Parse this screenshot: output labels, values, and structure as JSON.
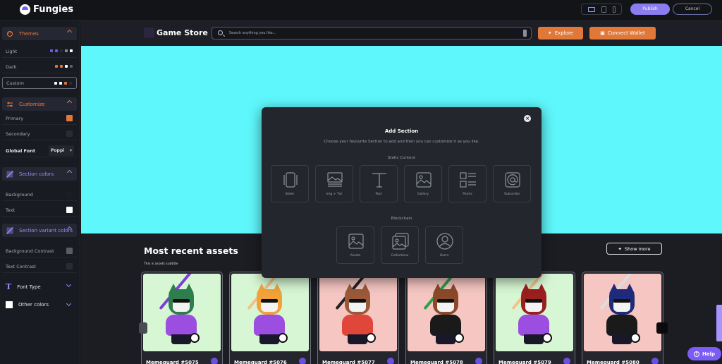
{
  "app": {
    "name": "Fungies",
    "publish_label": "Publish",
    "cancel_label": "Cancel"
  },
  "sidebar": {
    "themes_label": "Themes",
    "themes": [
      {
        "label": "Light",
        "colors": [
          "#6d5ce8",
          "#6d5ce8",
          "#2a2c34",
          "#8a8d96",
          "#ffffff"
        ]
      },
      {
        "label": "Dark",
        "colors": [
          "#e0783a",
          "#e0783a",
          "#ffffff",
          "#5c5f68"
        ]
      },
      {
        "label": "Custom",
        "colors": [
          "#ffffff",
          "#ffffff",
          "#e0783a",
          "#2a2c34"
        ]
      }
    ],
    "customize_label": "Customize",
    "primary_label": "Primary",
    "primary_color": "#e0783a",
    "secondary_label": "Secondary",
    "secondary_color": "#2a2c34",
    "global_font_label": "Global Font",
    "global_font_value": "Poppi",
    "section_colors_label": "Section colors",
    "background_label": "Background",
    "background_color": "#1c1d23",
    "text_label": "Text",
    "text_color": "#ffffff",
    "section_variant_label": "Section variant colors",
    "bg_contrast_label": "Background Contrast",
    "bg_contrast_color": "#5a5c63",
    "text_contrast_label": "Text Contrast",
    "text_contrast_color": "#2a2c34",
    "font_type_label": "Font Type",
    "other_colors_label": "Other colors"
  },
  "store": {
    "title": "Game Store",
    "search_placeholder": "Search anything you like...",
    "explore_label": "Explore",
    "connect_label": "Connect Wallet",
    "hero_color": "#5ef7fb",
    "recent_title": "Most recent assets",
    "recent_subtitle": "This is assets subtitle",
    "show_more_label": "Show more",
    "help_label": "Help"
  },
  "assets": [
    {
      "name": "Memeguard #5075",
      "bg": "#d7f7d4",
      "head": "#2e7d4f",
      "body": "#9b4ee0",
      "bat": "#7b3fd6"
    },
    {
      "name": "Memeguard #5076",
      "bg": "#d7f7d4",
      "head": "#f2a23a",
      "body": "#9b4ee0",
      "bat": "#f2c28a"
    },
    {
      "name": "Memeguard #5077",
      "bg": "#f5c6c2",
      "head": "#9a5a3a",
      "body": "#e0473a",
      "bat": "#222222"
    },
    {
      "name": "Memeguard #5078",
      "bg": "#f5c6c2",
      "head": "#8a4a2a",
      "body": "#1a1a1a",
      "bat": "#2e9e4a"
    },
    {
      "name": "Memeguard #5079",
      "bg": "#d7f7d4",
      "head": "#9a1f1f",
      "body": "#9b4ee0",
      "bat": "#f2c28a"
    },
    {
      "name": "Memeguard #5080",
      "bg": "#f5c6c2",
      "head": "#1f2a7a",
      "body": "#1a1a1a",
      "bat": "#dddddd"
    }
  ],
  "modal": {
    "title": "Add Section",
    "subtitle": "Choose your favourite Section to add and then you can customize it as you like.",
    "static_label": "Static Content",
    "static_items": [
      "Slider",
      "Img + Txt",
      "Text",
      "Gallery",
      "Points",
      "Subscribe"
    ],
    "blockchain_label": "Blockchain",
    "blockchain_items": [
      "Assets",
      "Collections",
      "Users"
    ],
    "close_label": "×"
  }
}
